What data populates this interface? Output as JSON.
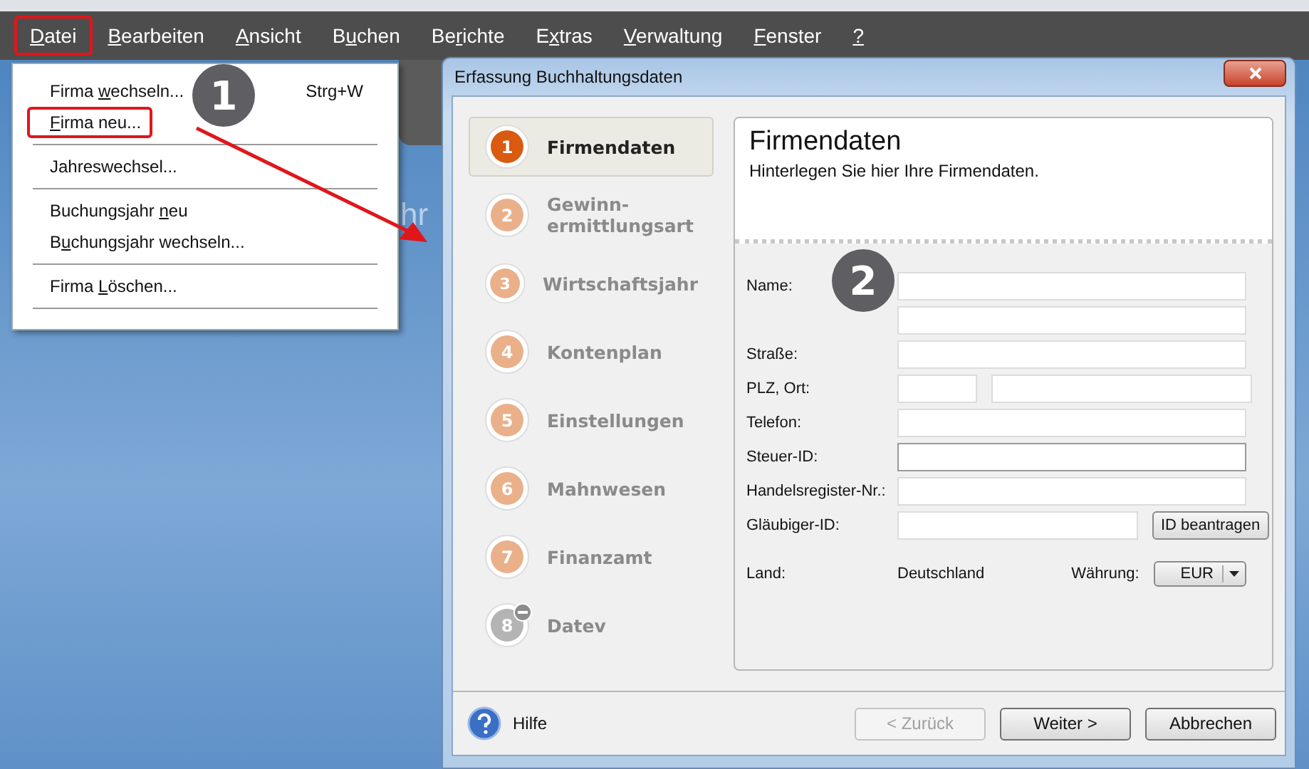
{
  "menu_bar": {
    "items": [
      {
        "key": "D",
        "post": "atei",
        "selected": true
      },
      {
        "key": "B",
        "post": "earbeiten",
        "selected": false
      },
      {
        "key": "A",
        "post": "nsicht",
        "selected": false
      },
      {
        "pre": "B",
        "key": "u",
        "post": "chen",
        "selected": false
      },
      {
        "pre": "Be",
        "key": "r",
        "post": "ichte",
        "selected": false
      },
      {
        "pre": "E",
        "key": "x",
        "post": "tras",
        "selected": false
      },
      {
        "key": "V",
        "post": "erwaltung",
        "selected": false
      },
      {
        "key": "F",
        "post": "enster",
        "selected": false
      },
      {
        "key": "?",
        "selected": false
      }
    ]
  },
  "background_text": "hr",
  "file_menu": {
    "items": [
      {
        "kind": "item",
        "pre": "Firma ",
        "key": "w",
        "post": "echseln...",
        "shortcut": "Strg+W",
        "highlighted": false
      },
      {
        "kind": "item",
        "key": "F",
        "post": "irma neu...",
        "highlighted": true
      },
      {
        "kind": "separator"
      },
      {
        "kind": "item",
        "pre": "Jahreswechsel...",
        "highlighted": false
      },
      {
        "kind": "separator"
      },
      {
        "kind": "item",
        "pre": "Buchungsjahr ",
        "key": "n",
        "post": "eu",
        "highlighted": false
      },
      {
        "kind": "item",
        "pre": "B",
        "key": "u",
        "post": "chungsjahr wechseln...",
        "highlighted": false
      },
      {
        "kind": "separator"
      },
      {
        "kind": "item",
        "pre": "Firma ",
        "key": "L",
        "post": "öschen...",
        "highlighted": false
      },
      {
        "kind": "separator"
      }
    ]
  },
  "annotations": [
    "1",
    "2"
  ],
  "dialog": {
    "title": "Erfassung Buchhaltungsdaten",
    "steps": [
      {
        "number": "1",
        "label": "Firmendaten",
        "selected": true,
        "disabled": false
      },
      {
        "number": "2",
        "label": "Gewinn-\nermittlungsart",
        "selected": false,
        "disabled": false
      },
      {
        "number": "3",
        "label": "Wirtschaftsjahr",
        "selected": false,
        "disabled": false
      },
      {
        "number": "4",
        "label": "Kontenplan",
        "selected": false,
        "disabled": false
      },
      {
        "number": "5",
        "label": "Einstellungen",
        "selected": false,
        "disabled": false
      },
      {
        "number": "6",
        "label": "Mahnwesen",
        "selected": false,
        "disabled": false
      },
      {
        "number": "7",
        "label": "Finanzamt",
        "selected": false,
        "disabled": false
      },
      {
        "number": "8",
        "label": "Datev",
        "selected": false,
        "disabled": true
      }
    ],
    "panel": {
      "heading": "Firmendaten",
      "subtitle": "Hinterlegen Sie hier Ihre Firmendaten.",
      "rows": [
        {
          "kind": "input",
          "label": "Name:",
          "inputs": [
            {
              "focused": false
            }
          ]
        },
        {
          "kind": "input",
          "inputs": [
            {
              "focused": false
            }
          ]
        },
        {
          "kind": "input",
          "label": "Straße:",
          "inputs": [
            {
              "focused": false
            }
          ]
        },
        {
          "kind": "input_pair",
          "label": "PLZ, Ort:",
          "inputs": [
            {
              "focused": false
            },
            {
              "focused": false
            }
          ]
        },
        {
          "kind": "input",
          "label": "Telefon:",
          "inputs": [
            {
              "focused": false
            }
          ]
        },
        {
          "kind": "input",
          "label": "Steuer-ID:",
          "inputs": [
            {
              "focused": true
            }
          ]
        },
        {
          "kind": "input",
          "label": "Handelsregister-Nr.:",
          "inputs": [
            {
              "focused": false
            }
          ]
        },
        {
          "kind": "input_button",
          "label": "Gläubiger-ID:",
          "inputs": [
            {
              "focused": false
            }
          ],
          "button": "ID beantragen"
        },
        {
          "kind": "info",
          "label": "Land:",
          "value": "Deutschland",
          "currency_label": "Währung:",
          "currency": "EUR"
        }
      ]
    },
    "footer": {
      "help": "Hilfe",
      "buttons": [
        {
          "label": "< Zurück",
          "disabled": true
        },
        {
          "label": "Weiter >",
          "disabled": false
        },
        {
          "label": "Abbrechen",
          "disabled": false
        }
      ]
    }
  }
}
